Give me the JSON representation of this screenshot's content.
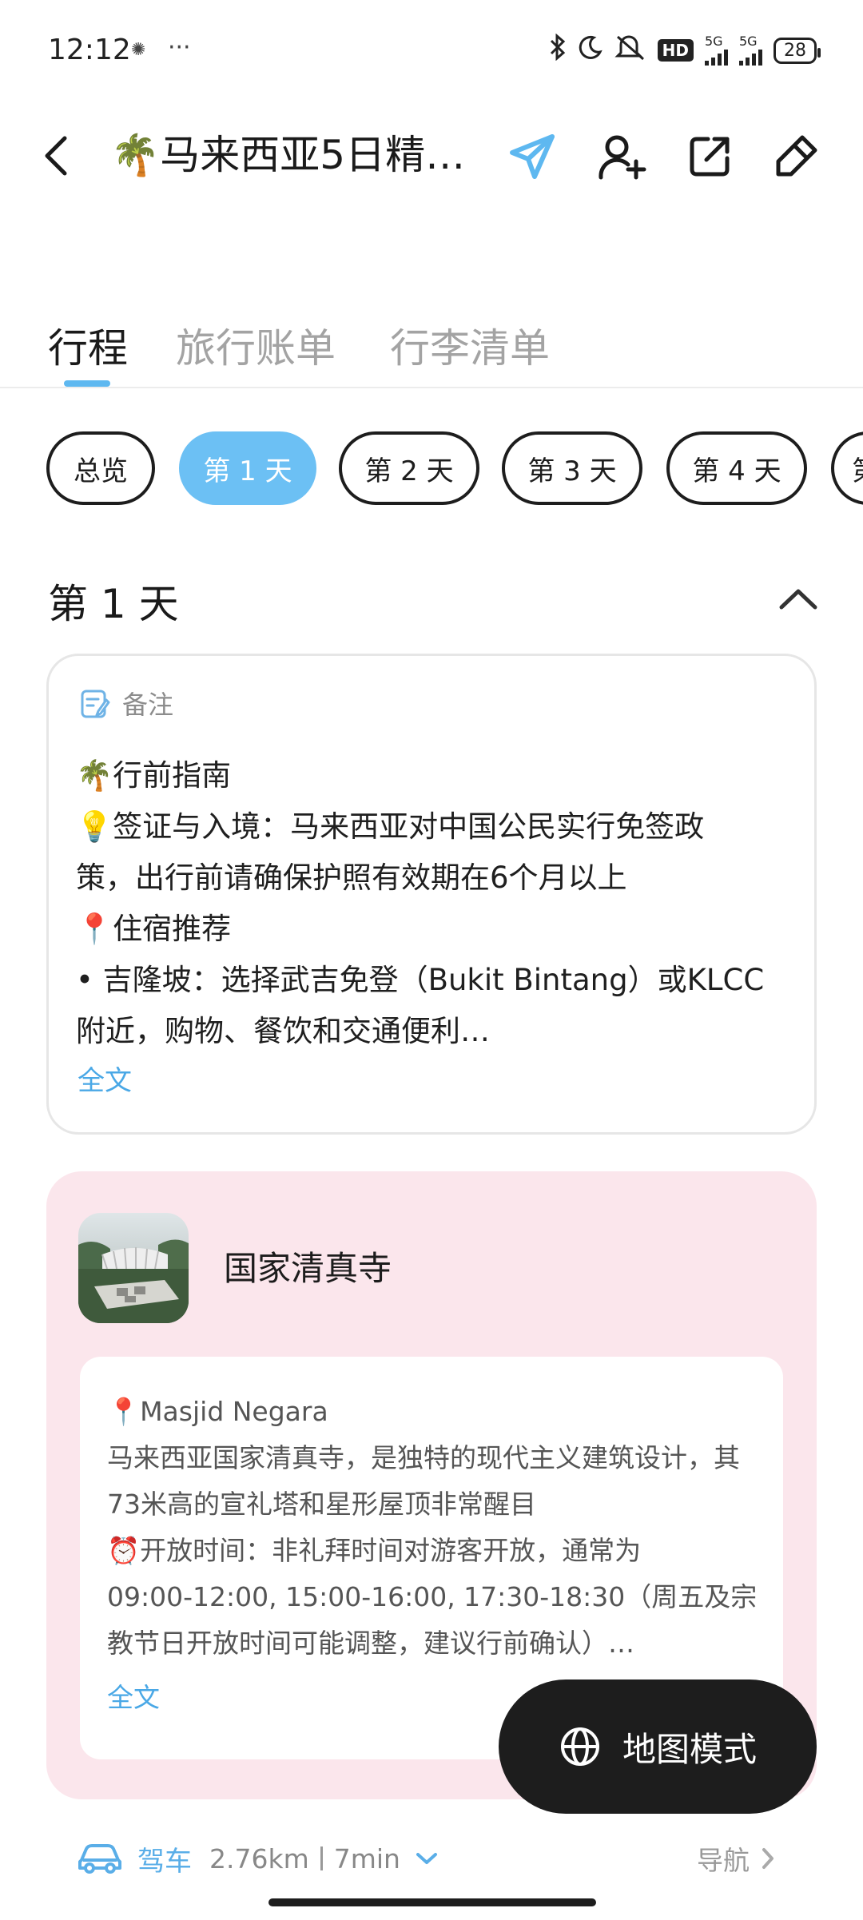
{
  "status_bar": {
    "time": "12:12",
    "more": "···",
    "hd": "HD",
    "net1": "5G",
    "net2": "5G",
    "battery": "28"
  },
  "header": {
    "title": "🌴马来西亚5日精…",
    "icons": [
      "back-icon",
      "send-icon",
      "add-user-icon",
      "share-icon",
      "edit-icon"
    ]
  },
  "tabs": [
    {
      "label": "行程",
      "active": true
    },
    {
      "label": "旅行账单",
      "active": false
    },
    {
      "label": "行李清单",
      "active": false
    }
  ],
  "day_chips": [
    {
      "label": "总览",
      "active": false
    },
    {
      "label": "第 1 天",
      "active": true
    },
    {
      "label": "第 2 天",
      "active": false
    },
    {
      "label": "第 3 天",
      "active": false
    },
    {
      "label": "第 4 天",
      "active": false
    },
    {
      "label": "第",
      "active": false
    }
  ],
  "day_section": {
    "title": "第 1 天"
  },
  "note": {
    "label": "备注",
    "lines": [
      "🌴行前指南",
      "💡签证与入境：马来西亚对中国公民实行免签政",
      "策，出行前请确保护照有效期在6个月以上",
      "📍住宿推荐",
      "• 吉隆坡：选择武吉免登（Bukit Bintang）或KLCC",
      "附近，购物、餐饮和交通便利…"
    ],
    "more": "全文"
  },
  "place": {
    "name": "国家清真寺",
    "lines": [
      "📍Masjid Negara",
      "马来西亚国家清真寺，是独特的现代主义建筑设计，其",
      "73米高的宣礼塔和星形屋顶非常醒目",
      "⏰开放时间：非礼拜时间对游客开放，通常为",
      "09:00-12:00, 15:00-16:00, 17:30-18:30（周五及宗",
      "教节日开放时间可能调整，建议行前确认）…"
    ],
    "more": "全文",
    "card_color": "#fbe6ec"
  },
  "map_button": {
    "label": "地图模式"
  },
  "route": {
    "mode": "驾车",
    "distance": "2.76km",
    "duration": "7min",
    "nav_label": "导航"
  },
  "colors": {
    "accent": "#5eb8f0",
    "link": "#4aa8e6"
  }
}
